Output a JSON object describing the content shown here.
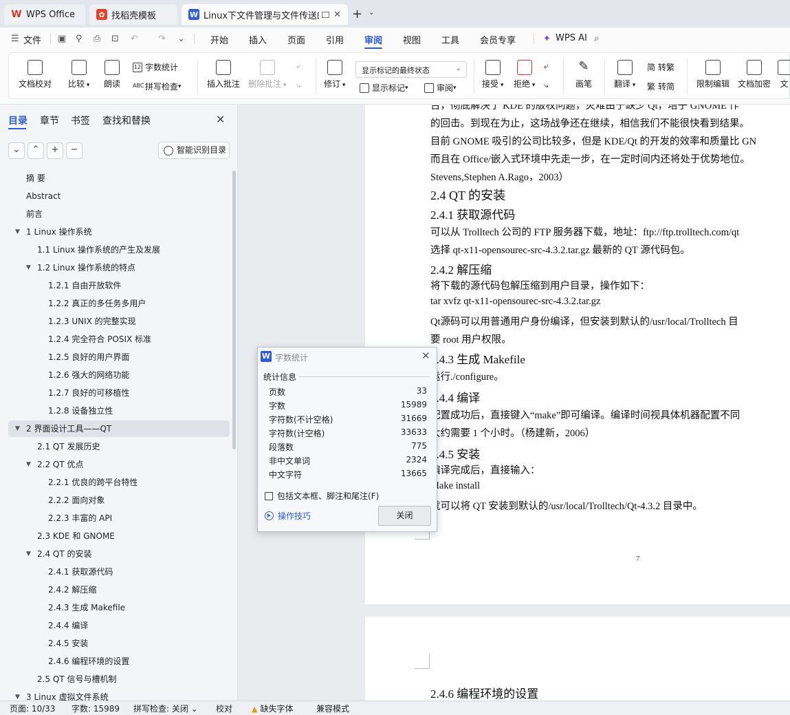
{
  "tabs": [
    {
      "label": "WPS Office",
      "icon": "wps-logo-icon"
    },
    {
      "label": "找稻壳模板",
      "icon": "docer-icon"
    },
    {
      "label": "Linux下文件管理与文件传送的",
      "icon": "writer-doc-icon"
    }
  ],
  "menu": {
    "file": "文件",
    "items": [
      "开始",
      "插入",
      "页面",
      "引用",
      "审阅",
      "视图",
      "工具",
      "会员专享"
    ],
    "active": "审阅",
    "ai": "WPS AI"
  },
  "ribbon": {
    "doc_proof": "文档校对",
    "compare": "比较",
    "read_aloud": "朗读",
    "word_count": "字数统计",
    "spell_check": "拼写检查",
    "insert_comment": "插入批注",
    "delete_comment": "删除批注",
    "track": "修订",
    "show_markup": "显示标记",
    "review_pane": "审阅",
    "markup_combo": "显示标记的最终状态",
    "accept": "接受",
    "reject": "拒绝",
    "pen": "画笔",
    "translate": "翻译",
    "to_trad": "转繁",
    "to_simp": "转简",
    "restrict": "限制编辑",
    "encrypt": "文档加密",
    "doc_cut": "文"
  },
  "nav": {
    "tabs": [
      "目录",
      "章节",
      "书签",
      "查找和替换"
    ],
    "active_tab": "目录",
    "smart_btn": "智能识别目录",
    "ctl_down": "⌄",
    "ctl_up": "⌃",
    "ctl_add": "+",
    "ctl_remove": "−",
    "toc": [
      {
        "text": "摘  要",
        "level": 0,
        "toggle": ""
      },
      {
        "text": "Abstract",
        "level": 0,
        "toggle": ""
      },
      {
        "text": "前言",
        "level": 0,
        "toggle": ""
      },
      {
        "text": "1  Linux 操作系统",
        "level": 0,
        "toggle": "▼"
      },
      {
        "text": "1.1  Linux 操作系统的产生及发展",
        "level": 1,
        "toggle": ""
      },
      {
        "text": "1.2 Linux 操作系统的特点",
        "level": 1,
        "toggle": "▼"
      },
      {
        "text": "1.2.1 自由开放软件",
        "level": 2,
        "toggle": ""
      },
      {
        "text": "1.2.2 真正的多任务多用户",
        "level": 2,
        "toggle": ""
      },
      {
        "text": "1.2.3 UNIX 的完整实现",
        "level": 2,
        "toggle": ""
      },
      {
        "text": "1.2.4 完全符合 POSIX 标准",
        "level": 2,
        "toggle": ""
      },
      {
        "text": "1.2.5 良好的用户界面",
        "level": 2,
        "toggle": ""
      },
      {
        "text": "1.2.6 强大的网络功能",
        "level": 2,
        "toggle": ""
      },
      {
        "text": "1.2.7 良好的可移植性",
        "level": 2,
        "toggle": ""
      },
      {
        "text": "1.2.8 设备独立性",
        "level": 2,
        "toggle": ""
      },
      {
        "text": "2  界面设计工具——QT",
        "level": 0,
        "toggle": "▼",
        "selected": true
      },
      {
        "text": "2.1  QT 发展历史",
        "level": 1,
        "toggle": ""
      },
      {
        "text": "2.2  QT 优点",
        "level": 1,
        "toggle": "▼"
      },
      {
        "text": "2.2.1 优良的跨平台特性",
        "level": 2,
        "toggle": ""
      },
      {
        "text": "2.2.2 面向对象",
        "level": 2,
        "toggle": ""
      },
      {
        "text": "2.2.3 丰富的 API",
        "level": 2,
        "toggle": ""
      },
      {
        "text": "2.3    KDE 和 GNOME",
        "level": 1,
        "toggle": ""
      },
      {
        "text": "2.4  QT 的安装",
        "level": 1,
        "toggle": "▼"
      },
      {
        "text": "2.4.1 获取源代码",
        "level": 2,
        "toggle": ""
      },
      {
        "text": "2.4.2 解压缩",
        "level": 2,
        "toggle": ""
      },
      {
        "text": "2.4.3 生成 Makefile",
        "level": 2,
        "toggle": ""
      },
      {
        "text": "2.4.4 编译",
        "level": 2,
        "toggle": ""
      },
      {
        "text": "2.4.5 安装",
        "level": 2,
        "toggle": ""
      },
      {
        "text": "2.4.6  编程环境的设置",
        "level": 2,
        "toggle": ""
      },
      {
        "text": "2.5  QT 信号与槽机制",
        "level": 1,
        "toggle": ""
      },
      {
        "text": "3  Linux 虚拟文件系统",
        "level": 0,
        "toggle": "▼"
      }
    ]
  },
  "document": {
    "lines": [
      {
        "text": "台，彻底解决了 KDE 的版权问题，灾难由于缺少 Qt，培子 GNOME 作",
        "style": "body"
      },
      {
        "text": "的回击。到现在为止，这场战争还在继续，相信我们不能很快看到结果。",
        "style": "body"
      },
      {
        "text": "目前 GNOME 吸引的公司比较多，但是 KDE/Qt 的开发的效率和质量比 GN",
        "style": "body"
      },
      {
        "text": "而且在 Office/嵌入式环境中先走一步，在一定时间内还将处于优势地位。",
        "style": "body"
      },
      {
        "text": "Stevens,Stephen A.Rago，2003）",
        "style": "body"
      },
      {
        "text": "2.4  QT 的安装",
        "style": "h2"
      },
      {
        "text": "2.4.1 获取源代码",
        "style": "h3"
      },
      {
        "text": "      可以从 Trolltech 公司的 FTP 服务器下载，地址：ftp://ftp.trolltech.com/qt",
        "style": "body"
      },
      {
        "text": "选择 qt-x11-opensourec-src-4.3.2.tar.gz 最新的 QT 源代码包。",
        "style": "body"
      },
      {
        "text": "2.4.2 解压缩",
        "style": "h3"
      },
      {
        "text": "      将下载的源代码包解压缩到用户目录，操作如下：",
        "style": "body"
      },
      {
        "text": "      tar  xvfz  qt-x11-opensourec-src-4.3.2.tar.gz",
        "style": "body"
      },
      {
        "text": "      Qt源码可以用普通用户身份编译，但安装到默认的/usr/local/Trolltech 目",
        "style": "body"
      },
      {
        "text": "要 root 用户权限。",
        "style": "body"
      },
      {
        "text": "2.4.3 生成 Makefile",
        "style": "h3"
      },
      {
        "text": "      运行./configure。",
        "style": "body"
      },
      {
        "text": "2.4.4 编译",
        "style": "h3"
      },
      {
        "text": "      配置成功后，直接键入“make”即可编译。编译时间视具体机器配置不同",
        "style": "body"
      },
      {
        "text": "大约需要 1 个小时。（杨建新，2006）",
        "style": "body"
      },
      {
        "text": "2.4.5 安装",
        "style": "h3"
      },
      {
        "text": "      编译完成后，直接输入：",
        "style": "body"
      },
      {
        "text": "      Make install",
        "style": "body"
      },
      {
        "text": "      就可以将 QT 安装到默认的/usr/local/Trolltech/Qt-4.3.2 目录中。",
        "style": "body"
      }
    ],
    "page_number": "7",
    "next_heading": "2.4.6  编程环境的设置"
  },
  "dialog": {
    "title": "字数统计",
    "section": "统计信息",
    "stats": [
      {
        "label": "页数",
        "value": "33"
      },
      {
        "label": "字数",
        "value": "15989"
      },
      {
        "label": "字符数(不计空格)",
        "value": "31669"
      },
      {
        "label": "字符数(计空格)",
        "value": "33633"
      },
      {
        "label": "段落数",
        "value": "775"
      },
      {
        "label": "非中文单词",
        "value": "2324"
      },
      {
        "label": "中文字符",
        "value": "13665"
      }
    ],
    "include_label": "包括文本框、脚注和尾注(F)",
    "tips": "操作技巧",
    "close": "关闭"
  },
  "status": {
    "page": "页面: 10/33",
    "words": "字数: 15989",
    "spell": "拼写检查: 关闭",
    "proof": "校对",
    "missing_font": "缺失字体",
    "compat": "兼容模式"
  },
  "colors": {
    "accent": "#2e5bdb",
    "wps_red": "#e0322b",
    "docer_red": "#e8412b"
  }
}
